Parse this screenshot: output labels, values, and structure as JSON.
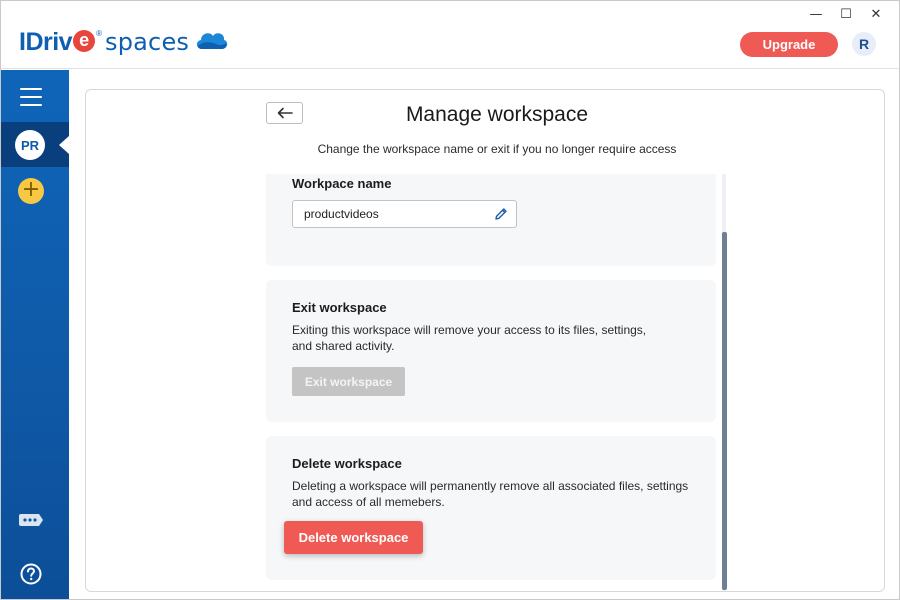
{
  "app": {
    "logo_brand": "IDriv",
    "logo_e": "e",
    "logo_reg": "®",
    "logo_product": "spaces",
    "upgrade_label": "Upgrade",
    "user_initial": "R",
    "window_controls": [
      "—",
      "☐",
      "✕"
    ]
  },
  "colors": {
    "brand_blue": "#0e5fb2",
    "accent_red": "#ef5b54",
    "sidebar_blue": "#0f5aa8",
    "add_yellow": "#f7c843"
  },
  "sidebar": {
    "active_workspace_initials": "PR",
    "add_label": "+",
    "icons": [
      "hamburger-menu-icon",
      "chat-bubble-icon",
      "help-circle-icon"
    ]
  },
  "main": {
    "title": "Manage workspace",
    "subtitle": "Change the workspace name or exit if you no longer require access",
    "name_section": {
      "heading": "Workpace name",
      "value": "productvideos"
    },
    "exit_section": {
      "heading": "Exit workspace",
      "description": "Exiting this workspace will remove your access to its files, settings, and shared activity.",
      "button_label": "Exit workspace"
    },
    "delete_section": {
      "heading": "Delete workspace",
      "description": "Deleting a workspace will permanently remove all associated files, settings and access of all memebers.",
      "button_label": "Delete workspace"
    }
  }
}
